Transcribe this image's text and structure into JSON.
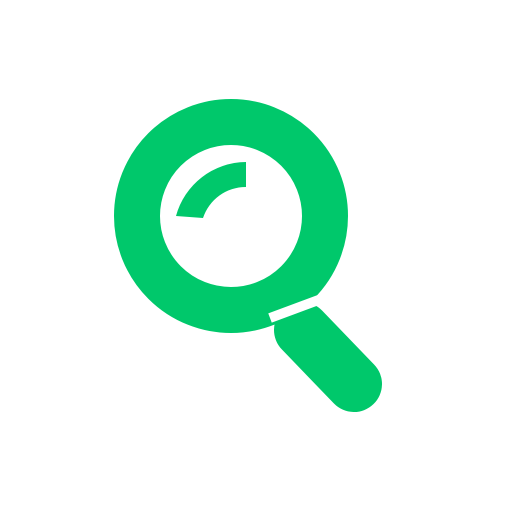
{
  "icon": {
    "name": "search-icon",
    "color": "#00C86B",
    "background": "#FFFFFF"
  }
}
